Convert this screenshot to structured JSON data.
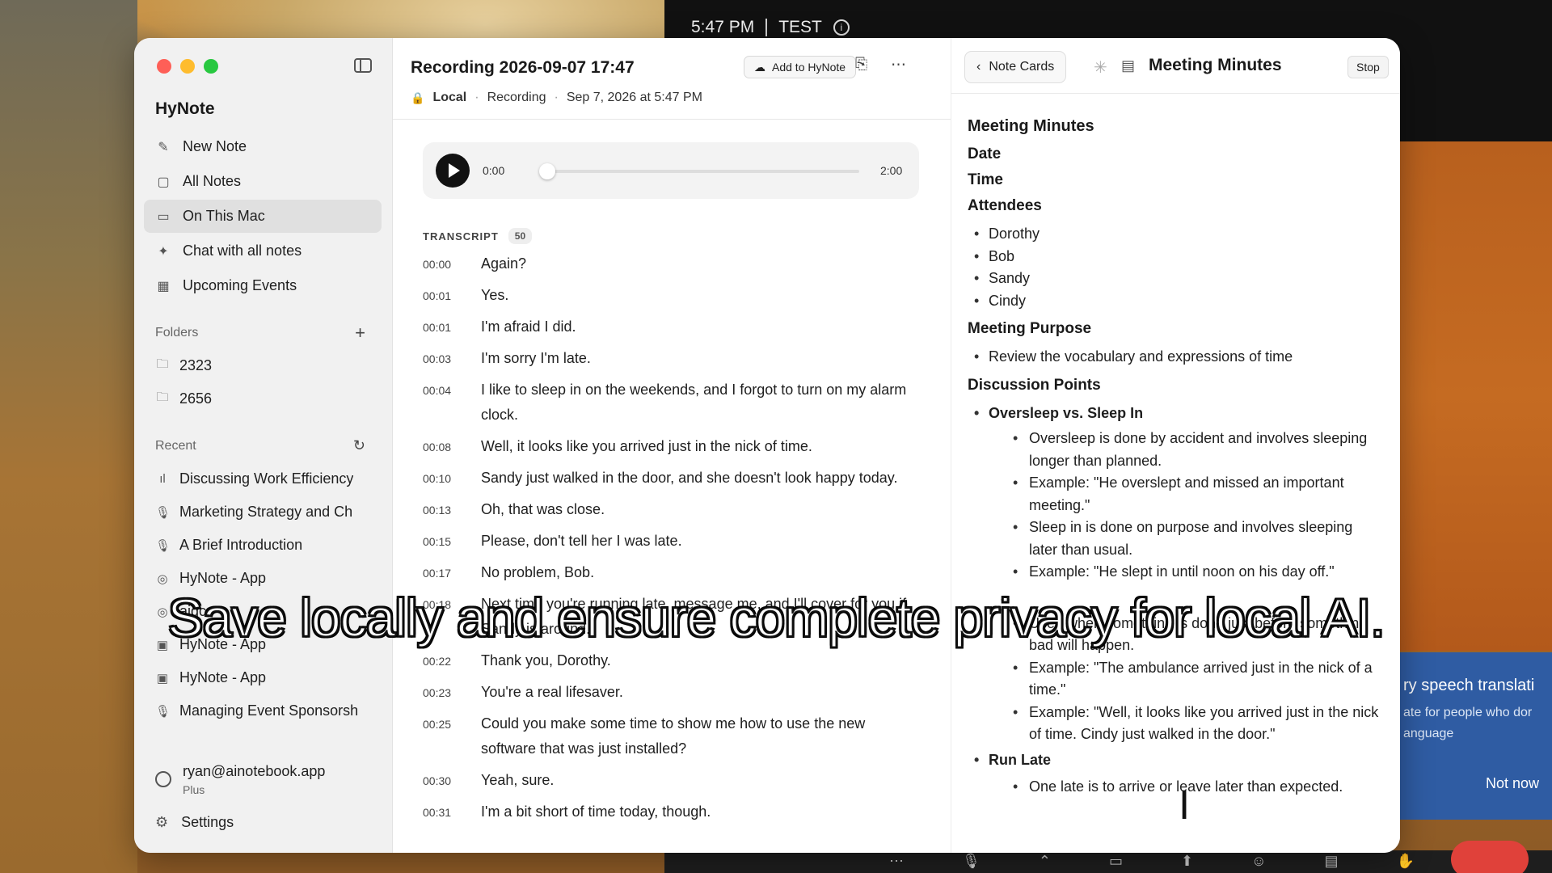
{
  "status": {
    "time": "5:47 PM",
    "label": "TEST"
  },
  "popup": {
    "title": "ry speech translati",
    "line1": "ate for people who dor",
    "line2": "anguage",
    "button": "Not now"
  },
  "sidebar": {
    "app_name": "HyNote",
    "nav": [
      {
        "label": "New Note",
        "icon": "edit-icon"
      },
      {
        "label": "All Notes",
        "icon": "notes-icon"
      },
      {
        "label": "On This Mac",
        "icon": "computer-icon"
      },
      {
        "label": "Chat with all notes",
        "icon": "sparkle-icon"
      },
      {
        "label": "Upcoming Events",
        "icon": "calendar-icon"
      }
    ],
    "folders_label": "Folders",
    "folders": [
      {
        "label": "2323"
      },
      {
        "label": "2656"
      }
    ],
    "recent_label": "Recent",
    "recent": [
      {
        "label": "Discussing Work Efficiency",
        "icon": "waveform-icon"
      },
      {
        "label": "Marketing Strategy and Ch",
        "icon": "mic-icon"
      },
      {
        "label": "A Brief Introduction",
        "icon": "mic-icon"
      },
      {
        "label": "HyNote - App",
        "icon": "globe-icon"
      },
      {
        "label": "aigc",
        "icon": "globe-icon"
      },
      {
        "label": "HyNote - App",
        "icon": "image-icon"
      },
      {
        "label": "HyNote - App",
        "icon": "image-icon"
      },
      {
        "label": "Managing Event Sponsorsh",
        "icon": "mic-icon"
      }
    ],
    "account": {
      "email": "ryan@ainotebook.app",
      "plan": "Plus"
    },
    "settings_label": "Settings"
  },
  "recording": {
    "title": "Recording 2026-09-07 17:47",
    "meta": {
      "location": "Local",
      "type": "Recording",
      "date": "Sep 7, 2026 at 5:47 PM"
    },
    "add_button": "Add to HyNote",
    "player": {
      "current": "0:00",
      "duration": "2:00",
      "progress": 0
    },
    "transcript_label": "TRANSCRIPT",
    "transcript_count": "50",
    "transcript": [
      {
        "time": "00:00",
        "text": "Again?"
      },
      {
        "time": "00:01",
        "text": "Yes."
      },
      {
        "time": "00:01",
        "text": "I'm afraid I did."
      },
      {
        "time": "00:03",
        "text": "I'm sorry I'm late."
      },
      {
        "time": "00:04",
        "text": "I like to sleep in on the weekends, and I forgot to turn on my alarm clock."
      },
      {
        "time": "00:08",
        "text": "Well, it looks like you arrived just in the nick of time."
      },
      {
        "time": "00:10",
        "text": "Sandy just walked in the door, and she doesn't look happy today."
      },
      {
        "time": "00:13",
        "text": "Oh, that was close."
      },
      {
        "time": "00:15",
        "text": "Please, don't tell her I was late."
      },
      {
        "time": "00:17",
        "text": "No problem, Bob."
      },
      {
        "time": "00:18",
        "text": "Next time you're running late, message me, and I'll cover for you if Sandy is around."
      },
      {
        "time": "00:22",
        "text": "Thank you, Dorothy."
      },
      {
        "time": "00:23",
        "text": "You're a real lifesaver."
      },
      {
        "time": "00:25",
        "text": "Could you make some time to show me how to use the new software that was just installed?"
      },
      {
        "time": "00:30",
        "text": "Yeah, sure."
      },
      {
        "time": "00:31",
        "text": "I'm a bit short of time today, though."
      }
    ]
  },
  "minutes_panel": {
    "back_label": "Note Cards",
    "title": "Meeting Minutes",
    "stop_label": "Stop",
    "heading": "Meeting Minutes",
    "date_label": "Date",
    "time_label": "Time",
    "attendees_label": "Attendees",
    "attendees": [
      "Dorothy",
      "Bob",
      "Sandy",
      "Cindy"
    ],
    "purpose_label": "Meeting Purpose",
    "purpose": "Review the vocabulary and expressions of time",
    "discussion_label": "Discussion Points",
    "topic1": "Oversleep vs. Sleep In",
    "topic1_points": [
      "Oversleep is done by accident and involves sleeping longer than planned.",
      "Example: \"He overslept and missed an important meeting.\"",
      "Sleep in is done on purpose and involves sleeping later than usual.",
      "Example: \"He slept in until noon on his day off.\""
    ],
    "topic2_points": [
      "Used when something is done just before something bad will happen.",
      "Example: \"The ambulance arrived just in the nick of a time.\"",
      "Example: \"Well, it looks like you arrived just in the nick of time. Cindy just walked in the door.\""
    ],
    "topic3": "Run Late",
    "topic3_points": [
      "One late is to arrive or leave later than expected."
    ]
  },
  "caption": "Save locally and ensure complete privacy for local AI."
}
